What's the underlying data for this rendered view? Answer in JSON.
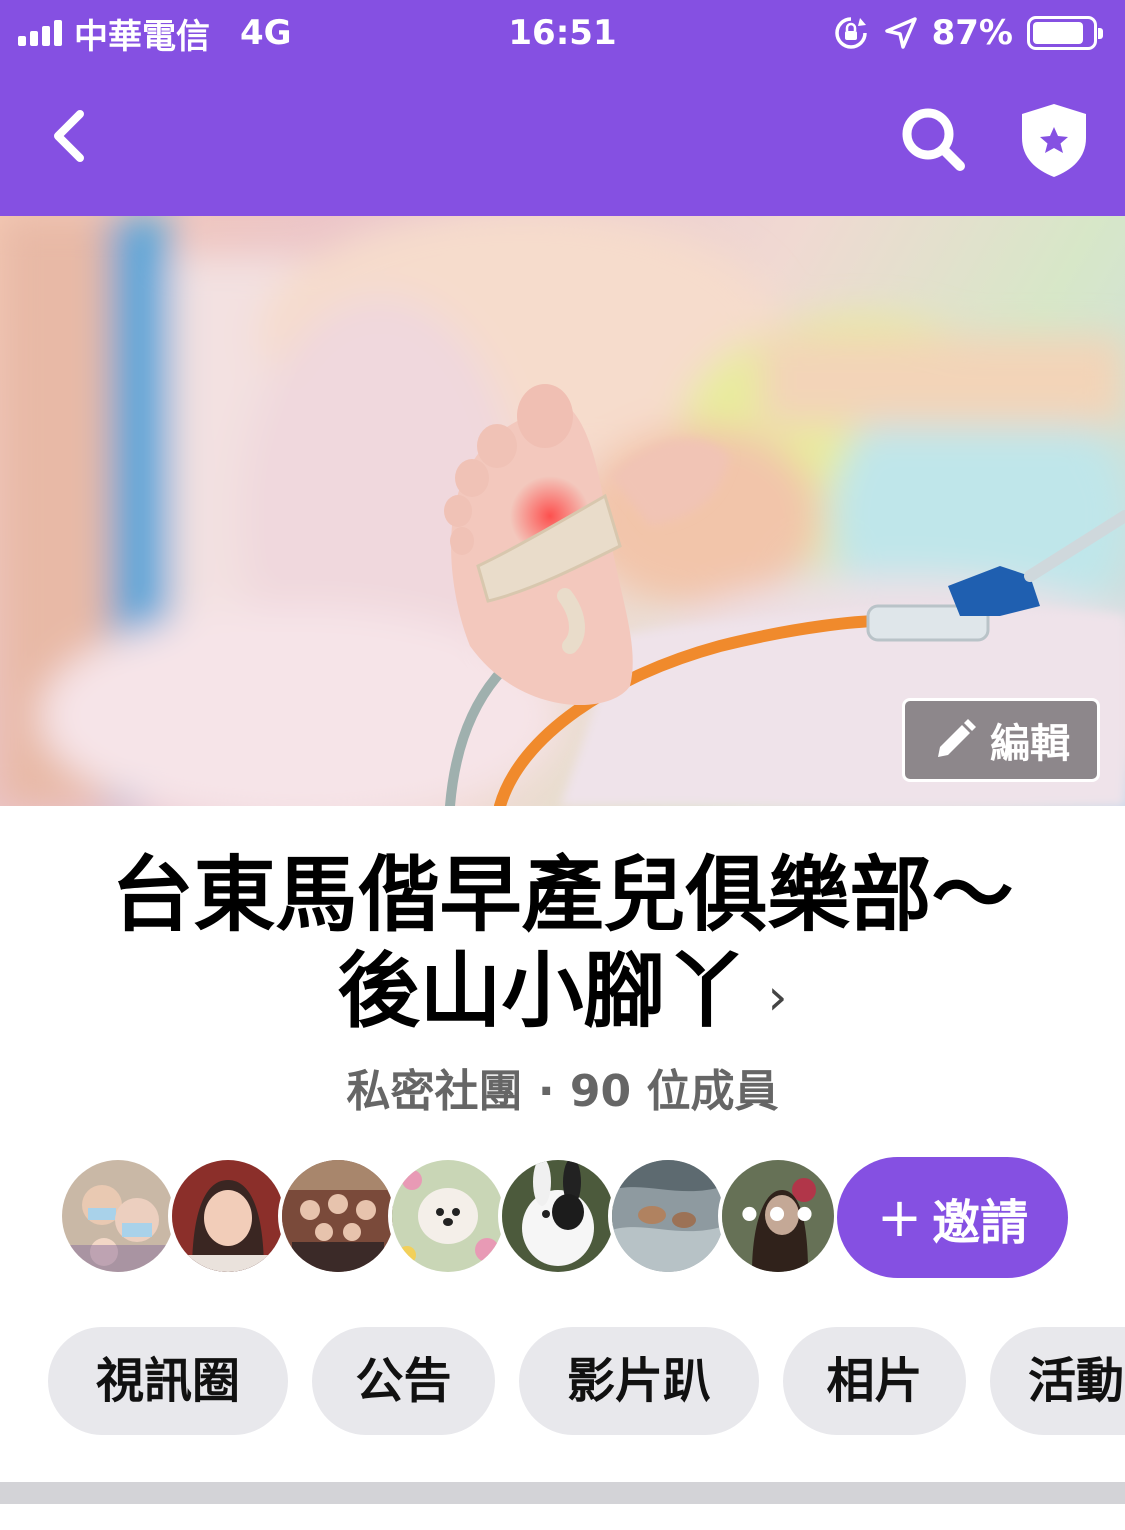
{
  "status_bar": {
    "carrier": "中華電信",
    "network": "4G",
    "time": "16:51",
    "battery": "87%",
    "battery_level": 0.87
  },
  "nav": {
    "back_icon": "chevron-left-icon",
    "search_icon": "search-icon",
    "admin_icon": "shield-star-icon"
  },
  "cover": {
    "edit_label": "編輯",
    "edit_icon": "pencil-icon"
  },
  "group": {
    "title_line1": "台東馬偕早產兒俱樂部～",
    "title_line2": "後山小腳丫",
    "chevron": "›",
    "meta": "私密社團 · 90 位成員"
  },
  "members": {
    "more": "•••",
    "invite_plus": "+",
    "invite_label": "邀請"
  },
  "tabs": [
    "視訊圈",
    "公告",
    "影片趴",
    "相片",
    "活動"
  ],
  "colors": {
    "brand": "#8550E2",
    "tab_bg": "#E8E8EC",
    "divider": "#D3D3D7"
  }
}
